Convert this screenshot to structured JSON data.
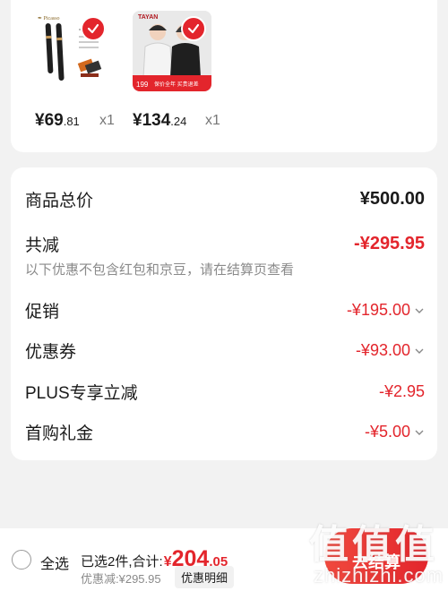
{
  "products": [
    {
      "name": "pen",
      "price_int": "¥69",
      "price_dec": ".81",
      "qty": "x1"
    },
    {
      "name": "jacket",
      "price_int": "¥134",
      "price_dec": ".24",
      "qty": "x1",
      "banner_brand": "TAYAN",
      "banner_price": "199",
      "banner_text": "保价全年 买贵退差"
    }
  ],
  "summary": {
    "total_label": "商品总价",
    "total_value": "¥500.00",
    "reduce_label": "共减",
    "reduce_value": "-¥295.95",
    "note": "以下优惠不包含红包和京豆，请在结算页查看",
    "items": [
      {
        "label": "促销",
        "value": "-¥195.00"
      },
      {
        "label": "优惠券",
        "value": "-¥93.00"
      },
      {
        "label": "PLUS专享立减",
        "value": "-¥2.95"
      },
      {
        "label": "首购礼金",
        "value": "-¥5.00"
      }
    ]
  },
  "bottom": {
    "select_all": "全选",
    "selected_text": "已选2件,合计:",
    "yen": "¥",
    "total_int": "204",
    "total_dec": ".05",
    "discount": "优惠减:¥295.95",
    "detail_button": "优惠明细",
    "checkout_button": "去结算"
  },
  "watermark": {
    "logo": "值值值",
    "site": "zhizhizhi.com"
  },
  "colors": {
    "accent": "#e3252c",
    "background": "#f2f2f2"
  }
}
